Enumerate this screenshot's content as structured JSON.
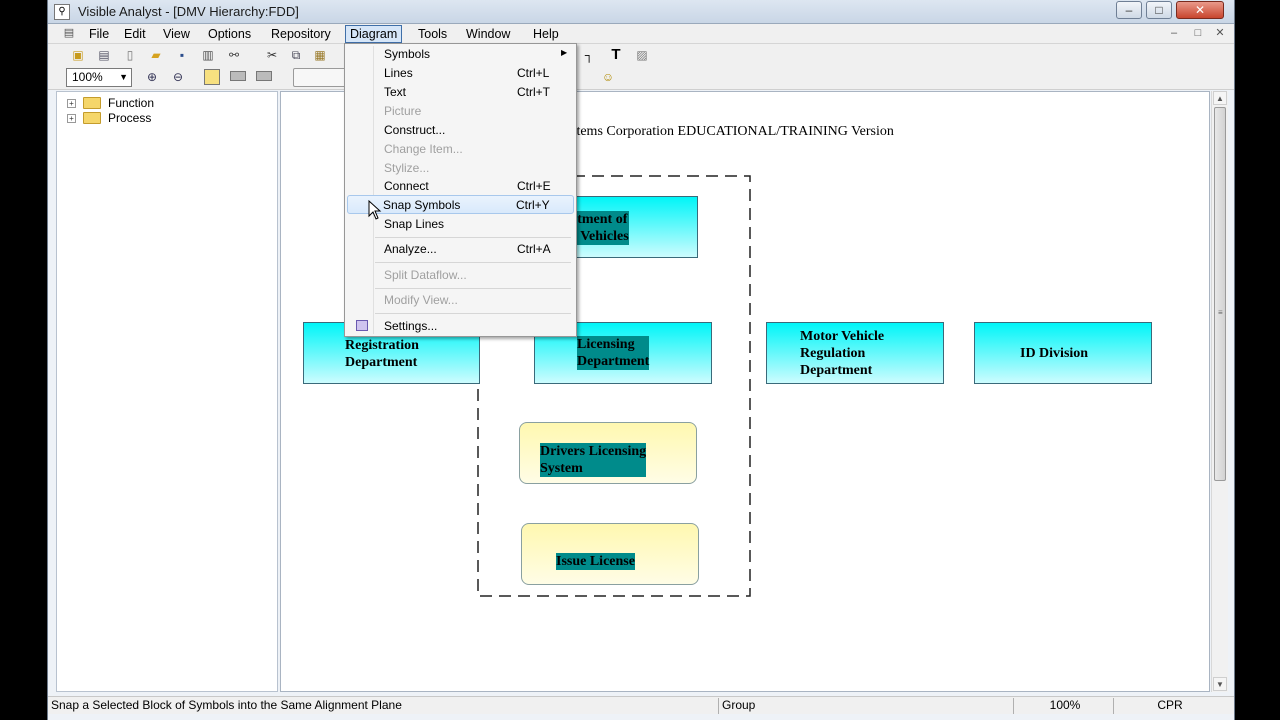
{
  "window": {
    "title": "Visible Analyst - [DMV Hierarchy:FDD]",
    "caption_buttons": [
      "–",
      "□",
      "✕"
    ],
    "mdi_buttons": [
      "–",
      "□",
      "✕"
    ]
  },
  "menubar": {
    "items": [
      "File",
      "Edit",
      "View",
      "Options",
      "Repository",
      "Diagram",
      "Tools",
      "Window",
      "Help"
    ],
    "active": "Diagram"
  },
  "toolbar": {
    "zoom_value": "100%"
  },
  "tree": {
    "items": [
      {
        "label": "Function"
      },
      {
        "label": "Process"
      }
    ]
  },
  "diagram_menu": {
    "items": [
      {
        "label": "Symbols",
        "shortcut": "",
        "disabled": false,
        "submenu": true
      },
      {
        "label": "Lines",
        "shortcut": "Ctrl+L",
        "disabled": false
      },
      {
        "label": "Text",
        "shortcut": "Ctrl+T",
        "disabled": false
      },
      {
        "label": "Picture",
        "shortcut": "",
        "disabled": true
      },
      {
        "label": "Construct...",
        "shortcut": "",
        "disabled": false
      },
      {
        "label": "Change Item...",
        "shortcut": "",
        "disabled": true
      },
      {
        "label": "Stylize...",
        "shortcut": "",
        "disabled": true
      },
      {
        "label": "Connect",
        "shortcut": "Ctrl+E",
        "disabled": false
      },
      {
        "label": "Snap Symbols",
        "shortcut": "Ctrl+Y",
        "disabled": false,
        "highlighted": true
      },
      {
        "label": "Snap Lines",
        "shortcut": "",
        "disabled": false
      },
      {
        "label": "Analyze...",
        "shortcut": "Ctrl+A",
        "disabled": false
      },
      {
        "label": "Split Dataflow...",
        "shortcut": "",
        "disabled": true
      },
      {
        "label": "Modify View...",
        "shortcut": "",
        "disabled": true
      },
      {
        "label": "Settings...",
        "shortcut": "",
        "disabled": false
      }
    ]
  },
  "diagram": {
    "watermark": "stems Corporation EDUCATIONAL/TRAINING Version",
    "nodes": [
      {
        "label": "artment of\nor Vehicles",
        "style": "rect",
        "highlight": true
      },
      {
        "label": "Registration\nDepartment",
        "style": "rect",
        "highlight": false
      },
      {
        "label": "Licensing\nDepartment",
        "style": "rect",
        "highlight": true
      },
      {
        "label": "Motor Vehicle\nRegulation\nDepartment",
        "style": "rect",
        "highlight": false
      },
      {
        "label": "ID Division",
        "style": "rect",
        "highlight": false
      },
      {
        "label": "Drivers Licensing\nSystem",
        "style": "round",
        "highlight": true
      },
      {
        "label": "Issue License",
        "style": "round",
        "highlight": true
      }
    ]
  },
  "statusbar": {
    "message": "Snap a Selected Block of Symbols into the Same Alignment Plane",
    "mode": "Group",
    "zoom": "100%",
    "indicator": "CPR"
  }
}
